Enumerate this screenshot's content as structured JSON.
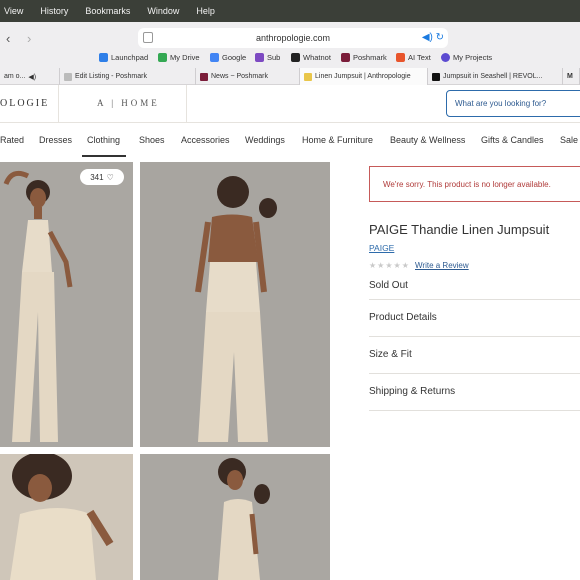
{
  "menubar": {
    "items": [
      "View",
      "History",
      "Bookmarks",
      "Window",
      "Help"
    ]
  },
  "browser": {
    "url": "anthropologie.com",
    "bookmarks": [
      {
        "label": "Launchpad",
        "color": "#2f7fe8"
      },
      {
        "label": "My Drive",
        "color": "#34a853"
      },
      {
        "label": "Google",
        "color": "#4285f4"
      },
      {
        "label": "Sub",
        "color": "#7d4ac2"
      },
      {
        "label": "Whatnot",
        "color": "#222222"
      },
      {
        "label": "Poshmark",
        "color": "#7b1d3a"
      },
      {
        "label": "AI Text",
        "color": "#e8552c"
      },
      {
        "label": "My Projects",
        "color": "#5c4bd1"
      }
    ],
    "tabs": [
      {
        "label": "am o...",
        "color": "#7b1d3a"
      },
      {
        "label": "Edit Listing - Poshmark",
        "color": "#bbbbbb"
      },
      {
        "label": "News ~ Poshmark",
        "color": "#7b1d3a"
      },
      {
        "label": "Linen Jumpsuit | Anthropologie",
        "color": "#e9c64a"
      },
      {
        "label": "Jumpsuit in Seashell | REVOL...",
        "color": "#111111"
      },
      {
        "label": "M",
        "color": "#111111"
      }
    ]
  },
  "site": {
    "logo": "OLOGIE",
    "home_link": "A | HOME",
    "search_placeholder": "What are you looking for?"
  },
  "nav": {
    "categories": [
      "Rated",
      "Dresses",
      "Clothing",
      "Shoes",
      "Accessories",
      "Weddings",
      "Home & Furniture",
      "Beauty & Wellness",
      "Gifts & Candles",
      "Sale"
    ]
  },
  "gallery": {
    "likes": "341"
  },
  "product": {
    "notice": "We're sorry. This product is no longer available.",
    "title": "PAIGE Thandie Linen Jumpsuit",
    "brand": "PAIGE",
    "stars": "★★★★★",
    "review_link": "Write a Review",
    "status": "Sold Out",
    "sections": [
      "Product Details",
      "Size & Fit",
      "Shipping & Returns"
    ]
  }
}
